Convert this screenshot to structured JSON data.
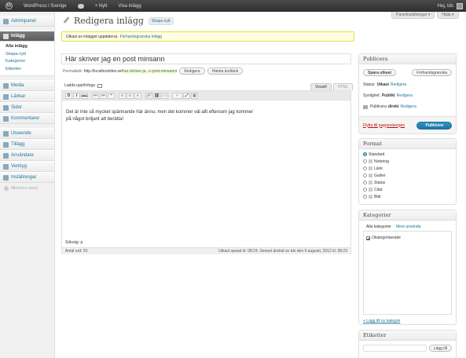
{
  "adminbar": {
    "site_name": "WordPress i Sverige",
    "new_label": "+ Nytt",
    "view_post": "Visa inlägg",
    "greeting": "Hej, tds"
  },
  "screen_meta": {
    "options": "Panelinställningar ▾",
    "help": "Hjälp ▾"
  },
  "sidebar": {
    "dashboard": "Adminpanel",
    "posts": "Inlägg",
    "posts_sub": [
      "Alla inlägg",
      "Skapa nytt",
      "Kategorier",
      "Etiketter"
    ],
    "group2": [
      "Media",
      "Länkar",
      "Sidor",
      "Kommentarer"
    ],
    "group3": [
      "Utseende",
      "Tillägg",
      "Användare",
      "Verktyg",
      "Inställningar"
    ],
    "collapse": "Minimera meny"
  },
  "page": {
    "title": "Redigera inlägg",
    "add_new": "Skapa nytt",
    "notice": "Utkast av inlägget uppdaterat.",
    "notice_link": "Förhandsgranska inlägg",
    "post_title": "Här skriver jag en post minsann",
    "permalink_label": "Permalänk:",
    "permalink_base": "http://localhost/dev.se/",
    "permalink_slug": "har-skriver-ja...n-post-minsann",
    "permalink_end": "/",
    "edit_btn": "Redigera",
    "shortlink_btn": "Hämta kortlänk",
    "upload_label": "Ladda upp/Infoga",
    "tab_visual": "Visuell",
    "tab_html": "HTML",
    "content_line1": "Det är inte så mycket spännande här ännu, men det kommer väl allt eftersom jag kommer",
    "content_line2": "på något briljant att berätta!",
    "path": "Sökväg: p",
    "word_count": "Antal ord: 20",
    "autosave": "Utkast sparat kl. 08:24. Senast ändrat av tds den 9 augusti, 2012 kl. 08:23"
  },
  "toolbar": {
    "buttons": [
      "B",
      "I",
      "ABC",
      "≔",
      "≔",
      "❝",
      "≡",
      "≡",
      "≡",
      "🔗",
      "⛓",
      "▭",
      "✓",
      "⤢",
      "▦"
    ]
  },
  "publish": {
    "title": "Publicera",
    "save_draft": "Spara utkast",
    "preview": "Förhandsgranska",
    "status_label": "Status:",
    "status_value": "Utkast",
    "status_edit": "Redigera",
    "visibility_label": "Synlighet:",
    "visibility_value": "Publikt",
    "visibility_edit": "Redigera",
    "schedule_label": "Publicera",
    "schedule_value": "direkt",
    "schedule_edit": "Redigera",
    "trash": "Flytta till papperskorgen",
    "publish_btn": "Publicera"
  },
  "format": {
    "title": "Format",
    "options": [
      "Standard",
      "Notering",
      "Länk",
      "Galleri",
      "Status",
      "Citat",
      "Bild"
    ],
    "selected": 0
  },
  "categories": {
    "title": "Kategorier",
    "tab_all": "Alla kategorier",
    "tab_popular": "Mest använda",
    "items": [
      {
        "label": "Okategoriserade",
        "checked": true
      }
    ],
    "add_new": "+ Lägg till ny kategori"
  },
  "tags": {
    "title": "Etiketter",
    "add_btn": "Lägg till"
  }
}
